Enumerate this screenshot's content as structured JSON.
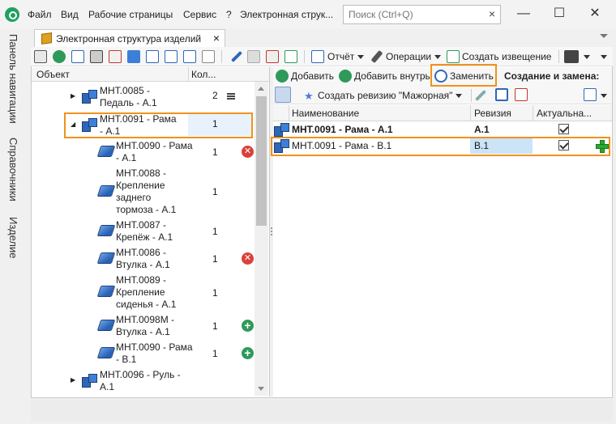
{
  "menu": {
    "file": "Файл",
    "view": "Вид",
    "workpages": "Рабочие страницы",
    "service": "Сервис",
    "help": "?",
    "window_title": "Электронная струк..."
  },
  "search": {
    "placeholder": "Поиск (Ctrl+Q)",
    "clear": "×"
  },
  "window_controls": {
    "minimize": "—",
    "maximize": "☐",
    "close": "✕"
  },
  "side_nav": {
    "navigation": "Панель навигации",
    "references": "Справочники",
    "product": "Изделие"
  },
  "doc_tab": {
    "title": "Электронная структура изделий",
    "close": "×"
  },
  "toolbar": {
    "report": "Отчёт",
    "operations": "Операции",
    "create_notice": "Создать извещение"
  },
  "tree": {
    "col_object": "Объект",
    "col_count": "Кол...",
    "rows": [
      {
        "name": "МНТ.0085 - Педаль - А.1",
        "count": "2",
        "kind": "assembly",
        "state": "collapsed",
        "badge": "menu"
      },
      {
        "name": "МНТ.0091 - Рама - А.1",
        "count": "1",
        "kind": "assembly",
        "state": "expanded",
        "badge": ""
      },
      {
        "name": "МНТ.0090 - Рама - А.1",
        "count": "1",
        "kind": "part",
        "badge": "remove"
      },
      {
        "name": "МНТ.0088 - Крепление заднего тормоза - А.1",
        "count": "1",
        "kind": "part",
        "badge": ""
      },
      {
        "name": "МНТ.0087 - Крепёж - А.1",
        "count": "1",
        "kind": "part",
        "badge": ""
      },
      {
        "name": "МНТ.0086 - Втулка - А.1",
        "count": "1",
        "kind": "part",
        "badge": "remove"
      },
      {
        "name": "МНТ.0089 - Крепление сиденья - А.1",
        "count": "1",
        "kind": "part",
        "badge": ""
      },
      {
        "name": "МНТ.0098М - Втулка - А.1",
        "count": "1",
        "kind": "part",
        "badge": "add"
      },
      {
        "name": "МНТ.0090 - Рама - В.1",
        "count": "1",
        "kind": "part",
        "badge": "add"
      },
      {
        "name": "МНТ.0096 - Руль - А.1",
        "count": "",
        "kind": "assembly",
        "state": "collapsed",
        "badge": ""
      }
    ]
  },
  "right_toolbar": {
    "add": "Добавить",
    "add_inside": "Добавить внутрь",
    "replace": "Заменить",
    "section": "Создание и замена:",
    "create_revision": "Создать ревизию \"Мажорная\""
  },
  "grid": {
    "col_name": "Наименование",
    "col_revision": "Ревизия",
    "col_actual": "Актуальна...",
    "rows": [
      {
        "name": "МНТ.0091 - Рама - А.1",
        "revision": "А.1",
        "actual": true,
        "bold": true
      },
      {
        "name": "МНТ.0091 - Рама - В.1",
        "revision": "В.1",
        "actual": true,
        "bold": false
      }
    ]
  },
  "colors": {
    "highlight": "#f0921c",
    "accent_green": "#2e9a5a",
    "accent_red": "#d9413a",
    "icon_blue": "#2f67b8"
  }
}
